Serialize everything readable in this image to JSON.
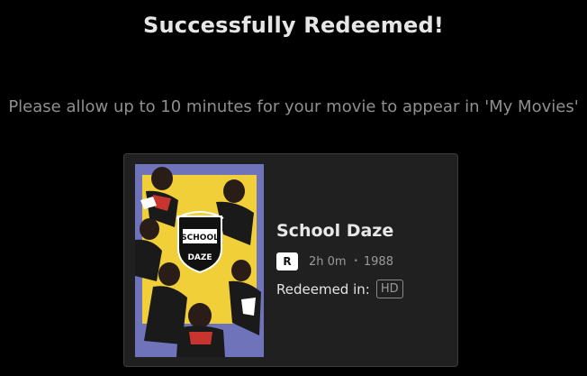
{
  "header": {
    "title": "Successfully Redeemed!",
    "subtitle": "Please allow up to 10 minutes for your movie to appear in 'My Movies'"
  },
  "movie": {
    "title": "School Daze",
    "rating": "R",
    "duration": "2h 0m",
    "separator": "•",
    "year": "1988",
    "redeemed_label": "Redeemed in:",
    "format": "HD",
    "poster": {
      "alt": "School Daze poster",
      "title_text": "SCHOOL DAZE"
    }
  },
  "colors": {
    "background": "#000000",
    "card_background": "#202020",
    "card_border": "#3c3c3c",
    "poster_yellow": "#f0cf38",
    "poster_blue": "#6f74ba"
  }
}
